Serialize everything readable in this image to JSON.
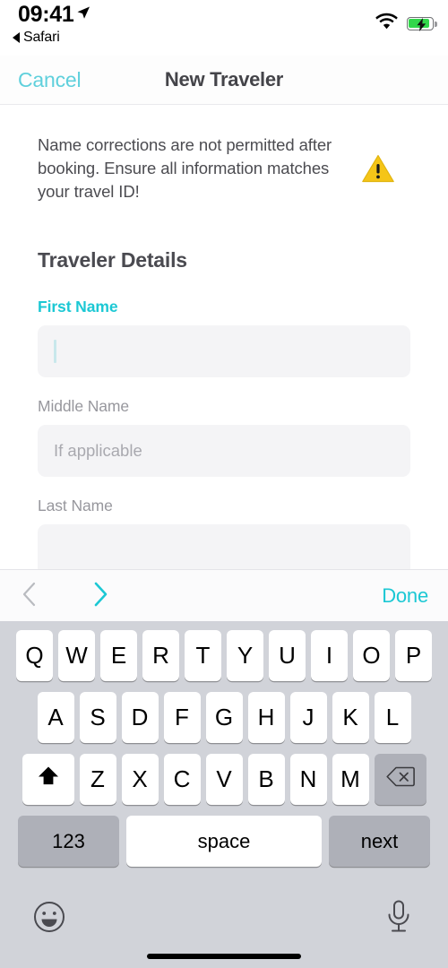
{
  "status_bar": {
    "time": "09:41",
    "location_icon": "location-arrow-icon",
    "back_app_label": "Safari",
    "wifi_icon": "wifi-icon",
    "battery_icon": "battery-charging-icon"
  },
  "nav": {
    "cancel_label": "Cancel",
    "title": "New Traveler"
  },
  "notice": {
    "text": "Name corrections are not permitted after booking. Ensure all information matches your travel ID!",
    "icon": "warning-triangle-icon"
  },
  "form": {
    "section_title": "Traveler Details",
    "fields": [
      {
        "label": "First Name",
        "value": "",
        "placeholder": "",
        "active": true
      },
      {
        "label": "Middle Name",
        "value": "",
        "placeholder": "If applicable",
        "active": false
      },
      {
        "label": "Last Name",
        "value": "",
        "placeholder": "",
        "active": false
      }
    ]
  },
  "accessory": {
    "prev_icon": "chevron-left-icon",
    "next_icon": "chevron-right-icon",
    "done_label": "Done"
  },
  "keyboard": {
    "row1": [
      "Q",
      "W",
      "E",
      "R",
      "T",
      "Y",
      "U",
      "I",
      "O",
      "P"
    ],
    "row2": [
      "A",
      "S",
      "D",
      "F",
      "G",
      "H",
      "J",
      "K",
      "L"
    ],
    "row3": [
      "Z",
      "X",
      "C",
      "V",
      "B",
      "N",
      "M"
    ],
    "shift_icon": "shift-up-arrow-icon",
    "delete_icon": "backspace-delete-icon",
    "numeric_label": "123",
    "space_label": "space",
    "return_label": "next",
    "emoji_icon": "emoji-smiley-icon",
    "dictation_icon": "microphone-icon"
  },
  "colors": {
    "accent_teal": "#1CC8D4",
    "cancel_teal": "#5FD0DC",
    "warning_yellow": "#F5C518",
    "battery_green": "#32D74B",
    "keyboard_bg": "#D1D3D9",
    "key_gray": "#AEB0B8",
    "field_bg": "#F4F4F6",
    "label_gray": "#97979D"
  }
}
